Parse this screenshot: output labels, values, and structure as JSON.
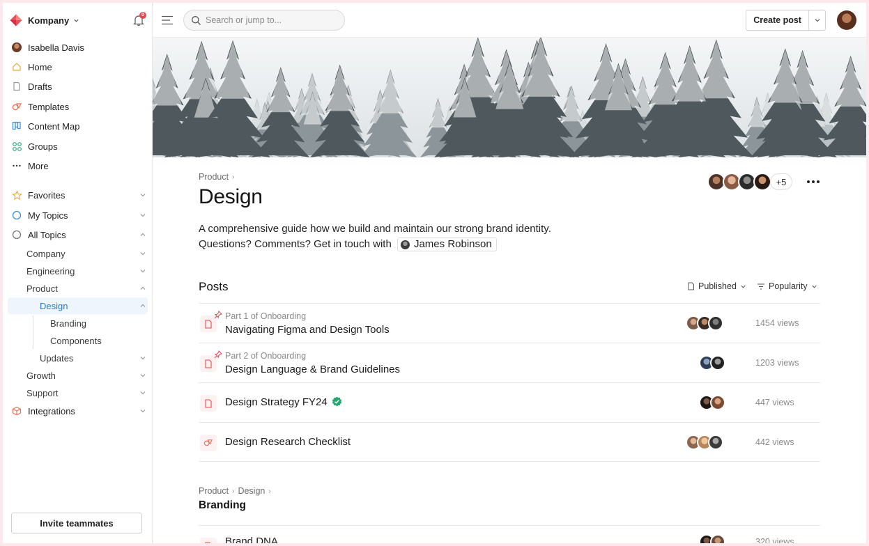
{
  "workspace": {
    "name": "Kompany",
    "notification_count": "0"
  },
  "sidebar": {
    "user": "Isabella Davis",
    "primary": [
      {
        "label": "Home",
        "icon": "home-icon"
      },
      {
        "label": "Drafts",
        "icon": "drafts-icon"
      },
      {
        "label": "Templates",
        "icon": "templates-icon"
      },
      {
        "label": "Content Map",
        "icon": "content-map-icon"
      },
      {
        "label": "Groups",
        "icon": "groups-icon"
      },
      {
        "label": "More",
        "icon": "more-icon"
      }
    ],
    "sections": [
      {
        "label": "Favorites",
        "icon": "star-icon"
      },
      {
        "label": "My Topics",
        "icon": "circle-icon"
      },
      {
        "label": "All Topics",
        "icon": "circle-icon"
      }
    ],
    "topics": [
      "Company",
      "Engineering",
      "Product",
      "Design",
      "Branding",
      "Components",
      "Updates",
      "Growth",
      "Support"
    ],
    "integrations": "Integrations",
    "invite_label": "Invite teammates"
  },
  "topbar": {
    "search_placeholder": "Search or jump to...",
    "create_label": "Create post"
  },
  "page": {
    "breadcrumb": [
      "Product"
    ],
    "title": "Design",
    "description_line1": "A comprehensive guide how we build and maintain our strong brand identity.",
    "description_line2": "Questions? Comments? Get in touch with",
    "contact": "James Robinson",
    "members_extra": "+5"
  },
  "posts": {
    "heading": "Posts",
    "filter_status": "Published",
    "filter_sort": "Popularity",
    "items": [
      {
        "subtitle": "Part 1 of Onboarding",
        "title": "Navigating Figma and Design Tools",
        "views": "1454 views",
        "pinned": true,
        "verified": false,
        "icon": "document-icon"
      },
      {
        "subtitle": "Part 2 of Onboarding",
        "title": "Design Language & Brand Guidelines",
        "views": "1203 views",
        "pinned": true,
        "verified": false,
        "icon": "document-icon"
      },
      {
        "subtitle": "",
        "title": "Design Strategy FY24",
        "views": "447 views",
        "pinned": false,
        "verified": true,
        "icon": "document-icon"
      },
      {
        "subtitle": "",
        "title": "Design Research Checklist",
        "views": "442 views",
        "pinned": false,
        "verified": false,
        "icon": "checklist-icon"
      }
    ]
  },
  "branding_section": {
    "breadcrumb": [
      "Product",
      "Design"
    ],
    "title": "Branding",
    "first_item_title": "Brand DNA",
    "first_item_views": "320 views"
  },
  "colors": {
    "accent": "#e5484d",
    "active_text": "#2b7ac9",
    "active_bg": "#eef5fc",
    "verified": "#1fa971"
  }
}
